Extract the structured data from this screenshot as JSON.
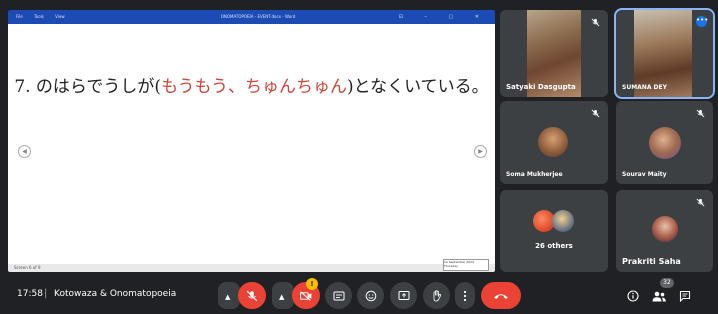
{
  "presentation": {
    "window_menu": [
      "File",
      "Tools",
      "View"
    ],
    "window_title": "ONOMATOPOEIA - EVENT.docx - Word",
    "slide_text_before": "7. のはらでうしが(",
    "slide_text_red": "もうもう、ちゅんちゅん",
    "slide_text_after": ")となくいている。",
    "status_left": "Screen 6 of 9",
    "status_popup": "12 September 2024 Thursday",
    "accent_color": "#d0453c"
  },
  "participants": [
    {
      "name": "Satyaki Dasgupta",
      "mic": "muted"
    },
    {
      "name": "SUMANA DEY",
      "mic": "speaking"
    },
    {
      "name": "Soma Mukherjee",
      "mic": "muted"
    },
    {
      "name": "Sourav Maity",
      "mic": "muted"
    },
    {
      "name": "26 others",
      "mic": "none"
    },
    {
      "name": "Prakriti Saha",
      "mic": "muted"
    }
  ],
  "meeting": {
    "time": "17:58",
    "separator": "|",
    "title": "Kotowaza & Onomatopoeia",
    "camera_badge": "!",
    "people_count": "32"
  },
  "icons": {
    "mic": "mic-off-icon",
    "camera": "camera-off-icon",
    "captions": "captions-icon",
    "emoji": "emoji-icon",
    "present": "present-icon",
    "hand": "raise-hand-icon",
    "more": "more-vert-icon",
    "end": "end-call-icon",
    "info": "info-icon",
    "people": "people-icon",
    "chat": "chat-icon"
  }
}
